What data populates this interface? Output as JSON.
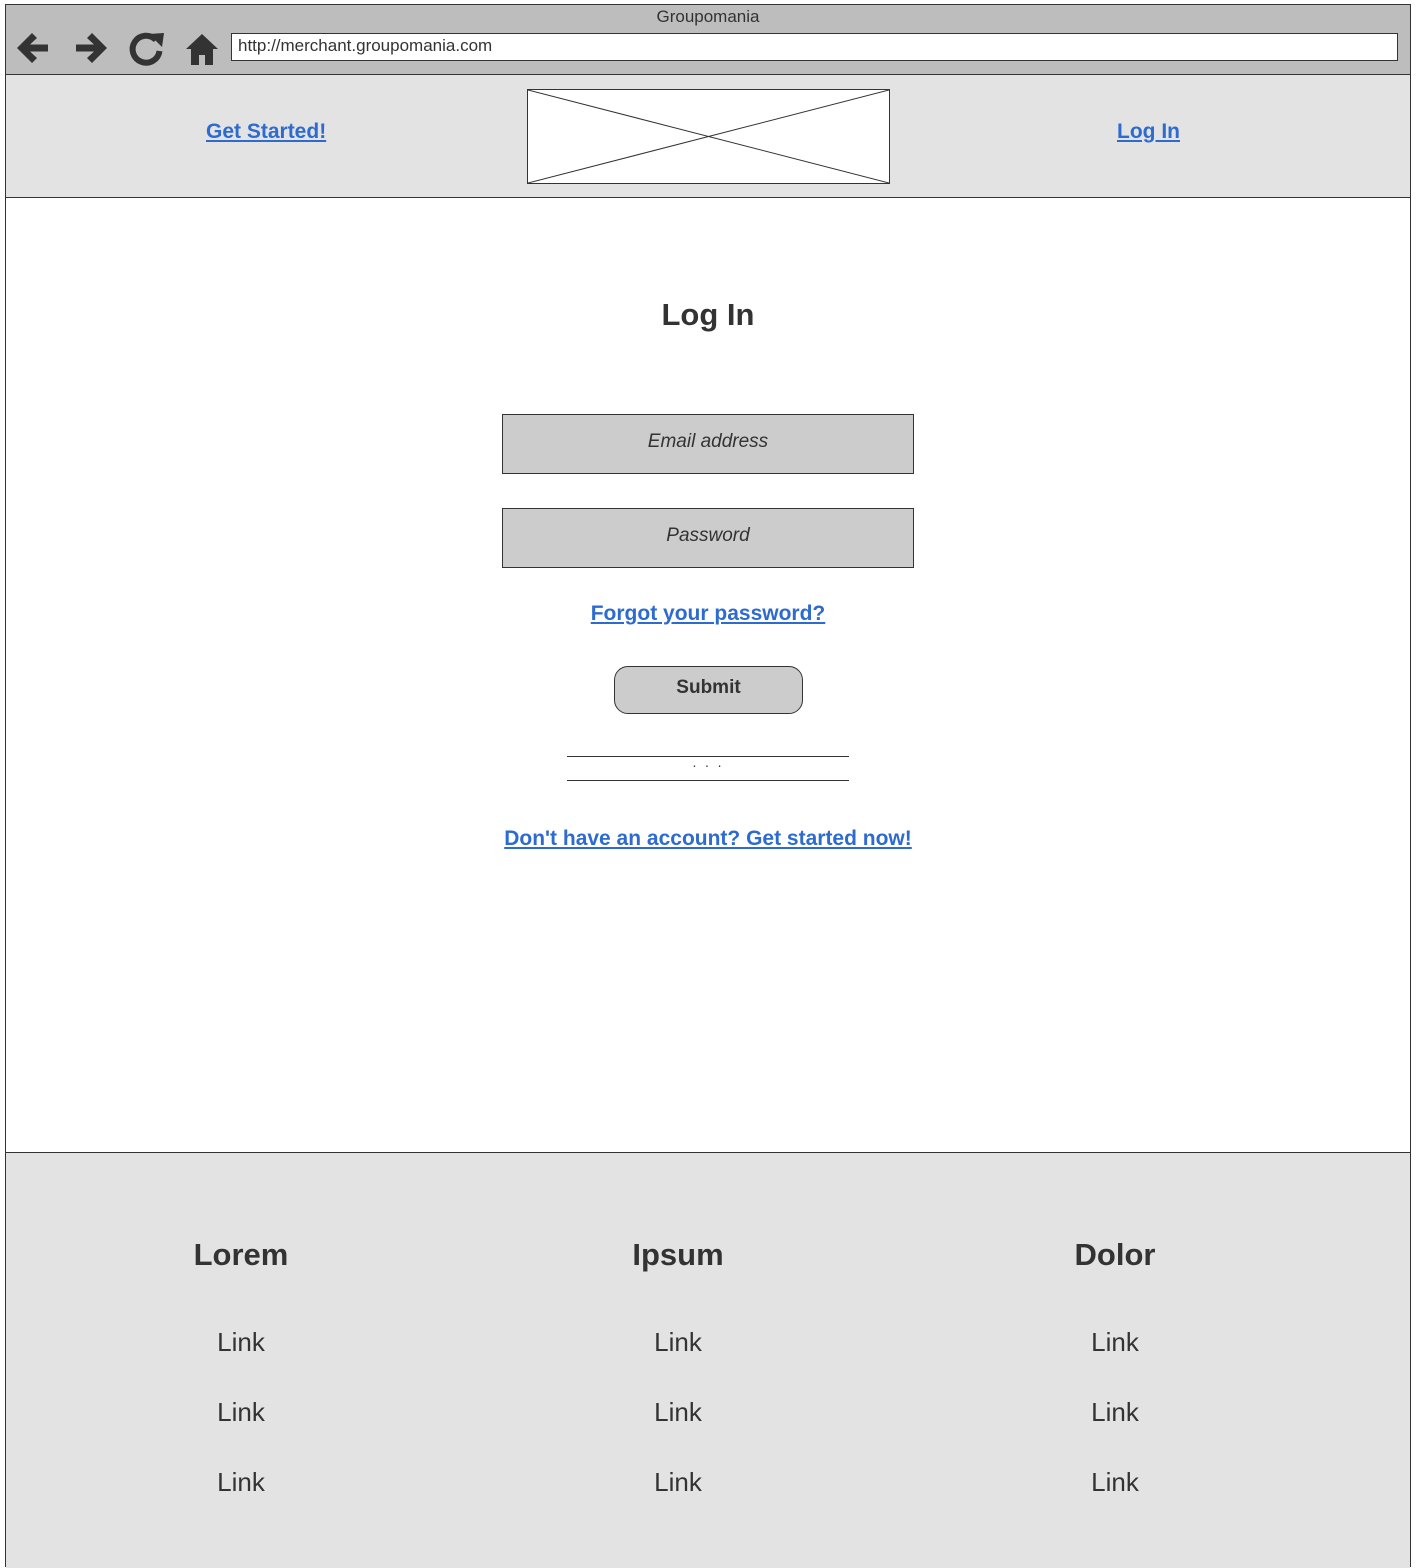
{
  "browser": {
    "window_title": "Groupomania",
    "url": "http://merchant.groupomania.com",
    "icons": [
      "back-arrow-icon",
      "forward-arrow-icon",
      "reload-icon",
      "home-icon"
    ]
  },
  "header": {
    "get_started_label": "Get Started!",
    "login_label": "Log In",
    "logo": "image-placeholder"
  },
  "main": {
    "title": "Log In",
    "email_placeholder": "Email address",
    "password_placeholder": "Password",
    "forgot_password_label": "Forgot your password?",
    "submit_label": "Submit",
    "divider_text": "· · ·",
    "signup_label": "Don't have an account? Get started now!"
  },
  "footer": {
    "columns": [
      {
        "heading": "Lorem",
        "links": [
          "Link",
          "Link",
          "Link"
        ]
      },
      {
        "heading": "Ipsum",
        "links": [
          "Link",
          "Link",
          "Link"
        ]
      },
      {
        "heading": "Dolor",
        "links": [
          "Link",
          "Link",
          "Link"
        ]
      }
    ]
  },
  "colors": {
    "link": "#2e6bcf",
    "chrome": "#bdbdbd",
    "header_footer_bg": "#e3e3e3",
    "field_bg": "#cccccc",
    "text": "#333333"
  }
}
